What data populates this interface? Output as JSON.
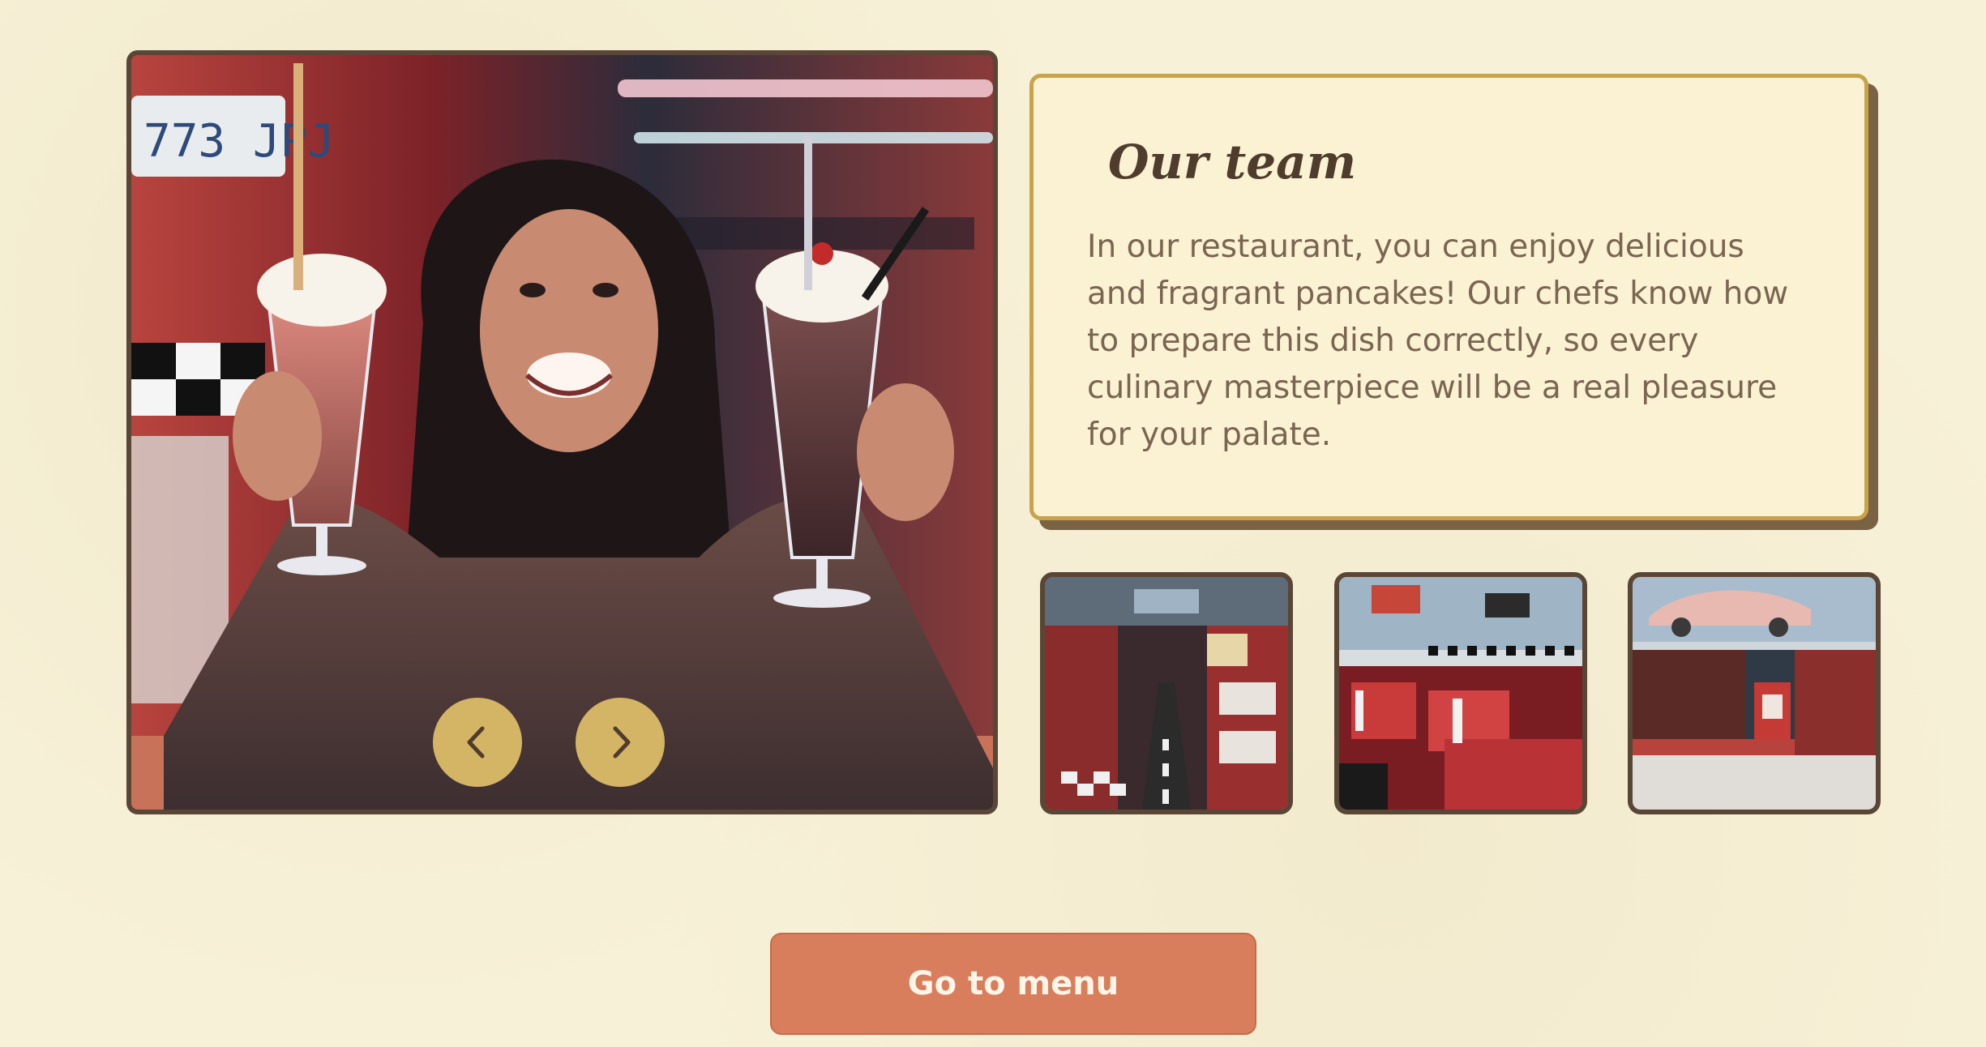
{
  "team": {
    "title": "Our team",
    "text": "In our restaurant, you can enjoy delicious and fragrant pancakes! Our chefs know how to prepare this dish correctly, so every culinary masterpiece will be a real pleasure for your palate."
  },
  "main_photo": {
    "plate_text": "773 JPJ",
    "subject": "woman holding two milkshakes in a diner"
  },
  "gallery": {
    "thumbnails": [
      {
        "subject": "diner interior with checkered floor"
      },
      {
        "subject": "diner red booths"
      },
      {
        "subject": "diner bar with car on ceiling"
      }
    ]
  },
  "cta": {
    "label": "Go to menu"
  },
  "colors": {
    "background": "#f7f1d8",
    "card_border": "#c9a24c",
    "arrow": "#d4b465",
    "button": "#d97e5c",
    "frame": "#5a4636"
  },
  "icons": {
    "prev": "chevron-left-icon",
    "next": "chevron-right-icon"
  }
}
